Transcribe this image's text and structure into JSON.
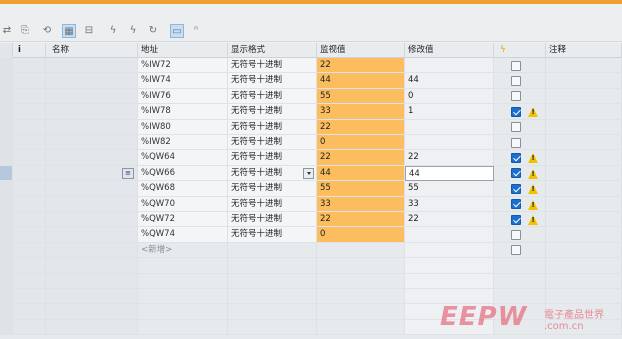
{
  "colors": {
    "top_bar": "#f0a030",
    "monitor_highlight": "#fbbd5e",
    "checkbox_on": "#1b6fd1",
    "warning": "#f2c200"
  },
  "toolbar": {
    "icons": [
      "update-icon",
      "copy-icon",
      "monitor-once-icon",
      "monitor-all-icon",
      "modify-icon",
      "modify-now-icon",
      "force-icon",
      "show-hide-columns-icon",
      "advanced-settings-icon"
    ]
  },
  "columns": {
    "info": "i",
    "name": "名称",
    "address": "地址",
    "display_format": "显示格式",
    "monitor_value": "监视值",
    "modify_value": "修改值",
    "modify_flag_icon": "lightning-icon",
    "comment": "注释"
  },
  "rows": [
    {
      "address": "%IW72",
      "format": "无符号十进制",
      "monitor": "22",
      "modify": "",
      "checked": false,
      "warning": false
    },
    {
      "address": "%IW74",
      "format": "无符号十进制",
      "monitor": "44",
      "modify": "44",
      "checked": false,
      "warning": false
    },
    {
      "address": "%IW76",
      "format": "无符号十进制",
      "monitor": "55",
      "modify": "0",
      "checked": false,
      "warning": false
    },
    {
      "address": "%IW78",
      "format": "无符号十进制",
      "monitor": "33",
      "modify": "1",
      "checked": true,
      "warning": true
    },
    {
      "address": "%IW80",
      "format": "无符号十进制",
      "monitor": "22",
      "modify": "",
      "checked": false,
      "warning": false
    },
    {
      "address": "%IW82",
      "format": "无符号十进制",
      "monitor": "0",
      "modify": "",
      "checked": false,
      "warning": false
    },
    {
      "address": "%QW64",
      "format": "无符号十进制",
      "monitor": "22",
      "modify": "22",
      "checked": true,
      "warning": true
    },
    {
      "address": "%QW66",
      "format": "无符号十进制",
      "monitor": "44",
      "modify": "44",
      "checked": true,
      "warning": true
    },
    {
      "address": "%QW68",
      "format": "无符号十进制",
      "monitor": "55",
      "modify": "55",
      "checked": true,
      "warning": true
    },
    {
      "address": "%QW70",
      "format": "无符号十进制",
      "monitor": "33",
      "modify": "33",
      "checked": true,
      "warning": true
    },
    {
      "address": "%QW72",
      "format": "无符号十进制",
      "monitor": "22",
      "modify": "22",
      "checked": true,
      "warning": true
    },
    {
      "address": "%QW74",
      "format": "无符号十进制",
      "monitor": "0",
      "modify": "",
      "checked": false,
      "warning": false
    }
  ],
  "add_row_placeholder": "<新增>",
  "watermark": {
    "logo": "EEPW",
    "tagline": "電子產品世界",
    "url": ".com.cn"
  }
}
